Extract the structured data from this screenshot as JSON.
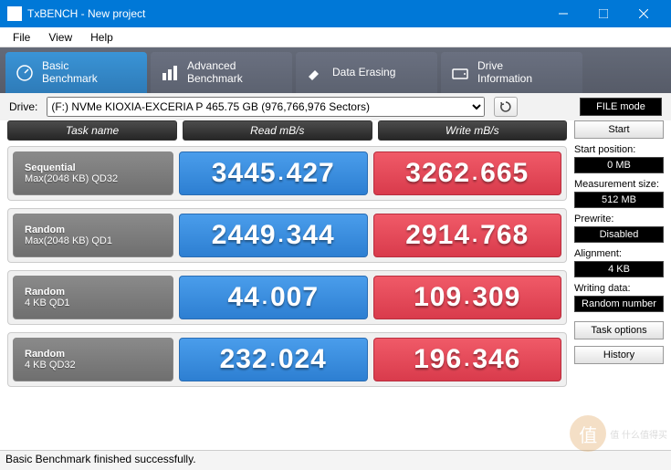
{
  "window": {
    "title": "TxBENCH - New project"
  },
  "menu": {
    "file": "File",
    "view": "View",
    "help": "Help"
  },
  "tabs": [
    {
      "l1": "Basic",
      "l2": "Benchmark"
    },
    {
      "l1": "Advanced",
      "l2": "Benchmark"
    },
    {
      "l1": "Data Erasing",
      "l2": ""
    },
    {
      "l1": "Drive",
      "l2": "Information"
    }
  ],
  "drive": {
    "label": "Drive:",
    "selected": "(F:) NVMe KIOXIA-EXCERIA P  465.75 GB (976,766,976 Sectors)",
    "filemode": "FILE mode"
  },
  "headers": {
    "task": "Task name",
    "read": "Read mB/s",
    "write": "Write mB/s"
  },
  "rows": [
    {
      "t1": "Sequential",
      "t2": "Max(2048 KB) QD32",
      "read": "3445.427",
      "write": "3262.665"
    },
    {
      "t1": "Random",
      "t2": "Max(2048 KB) QD1",
      "read": "2449.344",
      "write": "2914.768"
    },
    {
      "t1": "Random",
      "t2": "4 KB QD1",
      "read": "44.007",
      "write": "109.309"
    },
    {
      "t1": "Random",
      "t2": "4 KB QD32",
      "read": "232.024",
      "write": "196.346"
    }
  ],
  "side": {
    "start": "Start",
    "startpos_label": "Start position:",
    "startpos": "0 MB",
    "msize_label": "Measurement size:",
    "msize": "512 MB",
    "prewrite_label": "Prewrite:",
    "prewrite": "Disabled",
    "align_label": "Alignment:",
    "align": "4 KB",
    "wdata_label": "Writing data:",
    "wdata": "Random number",
    "taskopts": "Task options",
    "history": "History"
  },
  "status": "Basic Benchmark finished successfully.",
  "watermark": "值 什么值得买"
}
